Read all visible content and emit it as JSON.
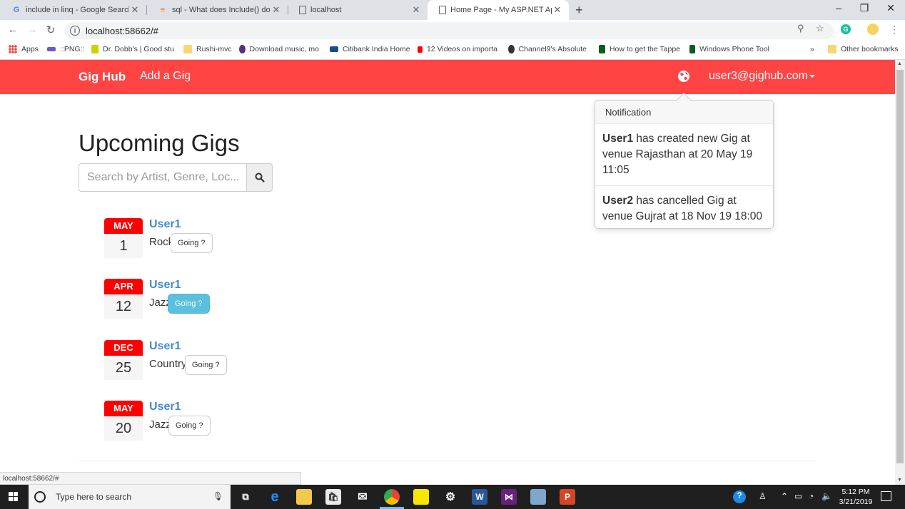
{
  "browser": {
    "tabs": [
      {
        "label": "include in linq - Google Search",
        "icon": "google-icon"
      },
      {
        "label": "sql - What does Include() do in LI",
        "icon": "stackoverflow-icon"
      },
      {
        "label": "localhost",
        "icon": "page-icon"
      },
      {
        "label": "Home Page - My ASP.NET Applic",
        "icon": "page-icon",
        "active": true
      }
    ],
    "new_tab": "+",
    "address": "localhost:58662/#",
    "bookmarks": [
      "Apps",
      "::PNG::",
      "Dr. Dobb's | Good stu",
      "Rushi-mvc",
      "Download music, mo",
      "Citibank India Home",
      "12 Videos on importa",
      "Channel9's Absolute",
      "How to get the Tappe",
      "Windows Phone Tool",
      "Other bookmarks"
    ],
    "bookmarks_overflow": "»",
    "status_url": "localhost:58662/#"
  },
  "app": {
    "brand": "Gig Hub",
    "nav_add": "Add a Gig",
    "user": "user3@gighub.com",
    "accent": "#ff4444"
  },
  "main": {
    "title": "Upcoming Gigs",
    "search_placeholder": "Search by Artist, Genre, Loc...",
    "gigs": [
      {
        "month": "MAY",
        "day": "1",
        "artist": "User1",
        "genre": "Rock",
        "going": "Going ?",
        "going_active": false
      },
      {
        "month": "APR",
        "day": "12",
        "artist": "User1",
        "genre": "Jazz",
        "going": "Going ?",
        "going_active": true
      },
      {
        "month": "DEC",
        "day": "25",
        "artist": "User1",
        "genre": "Country",
        "going": "Going ?",
        "going_active": false
      },
      {
        "month": "MAY",
        "day": "20",
        "artist": "User1",
        "genre": "Jazz",
        "going": "Going ?",
        "going_active": false
      }
    ]
  },
  "popover": {
    "title": "Notification",
    "items": [
      {
        "user": "User1",
        "text": " has created new Gig at venue Rajasthan at 20 May 19 11:05"
      },
      {
        "user": "User2",
        "text": " has cancelled Gig at venue Gujrat at 18 Nov 19 18:00"
      }
    ]
  },
  "taskbar": {
    "search_placeholder": "Type here to search",
    "time": "5:12 PM",
    "date": "3/21/2019"
  }
}
